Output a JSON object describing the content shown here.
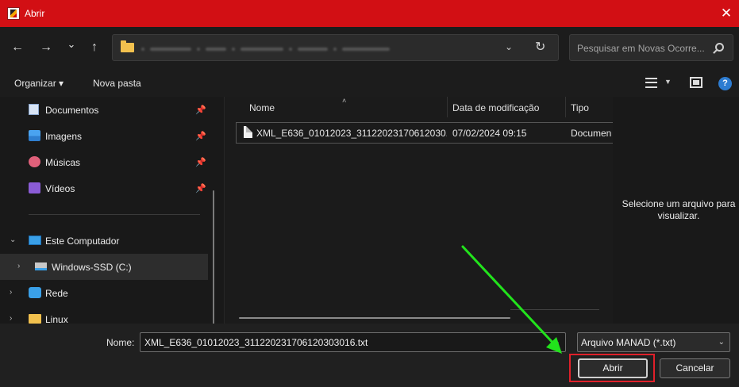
{
  "window": {
    "title": "Abrir",
    "close_glyph": "✕"
  },
  "navigation": {
    "back_glyph": "←",
    "forward_glyph": "→",
    "recent_glyph": "⌄",
    "up_glyph": "↑",
    "address_dropdown_glyph": "⌄",
    "refresh_glyph": "↻"
  },
  "search": {
    "placeholder": "Pesquisar em Novas Ocorre..."
  },
  "toolbar": {
    "organize_label": "Organizar ▾",
    "new_folder_label": "Nova pasta",
    "help_glyph": "?"
  },
  "sidebar": {
    "items": [
      {
        "label": "Documentos",
        "icon": "documents-icon",
        "pinned": true
      },
      {
        "label": "Imagens",
        "icon": "pictures-icon",
        "pinned": true
      },
      {
        "label": "Músicas",
        "icon": "music-icon",
        "pinned": true
      },
      {
        "label": "Vídeos",
        "icon": "videos-icon",
        "pinned": true
      },
      {
        "label": "Este Computador",
        "icon": "computer-icon",
        "expanded": true
      },
      {
        "label": "Windows-SSD (C:)",
        "icon": "drive-icon",
        "selected": true
      },
      {
        "label": "Rede",
        "icon": "network-icon"
      },
      {
        "label": "Linux",
        "icon": "linux-folder-icon"
      }
    ],
    "pin_glyph": "📌",
    "expand_glyph": "›",
    "expanded_glyph": "⌄"
  },
  "file_list": {
    "columns": [
      "Nome",
      "Data de modificação",
      "Tipo"
    ],
    "sort_glyph": "˄",
    "rows": [
      {
        "name": "XML_E636_01012023_31122023170612030...",
        "modified": "07/02/2024 09:15",
        "type": "Documen"
      }
    ]
  },
  "preview": {
    "line1": "Selecione um arquivo para",
    "line2": "visualizar."
  },
  "footer": {
    "name_label": "Nome:",
    "name_value": "XML_E636_01012023_31122023170612030301​6.txt",
    "filter_value": "Arquivo MANAD (*.txt)",
    "open_label": "Abrir",
    "cancel_label": "Cancelar",
    "dropdown_glyph": "⌄"
  },
  "colors": {
    "titlebar": "#d20f14",
    "highlight": "#e0202a",
    "annotation_arrow": "#22e31c"
  }
}
